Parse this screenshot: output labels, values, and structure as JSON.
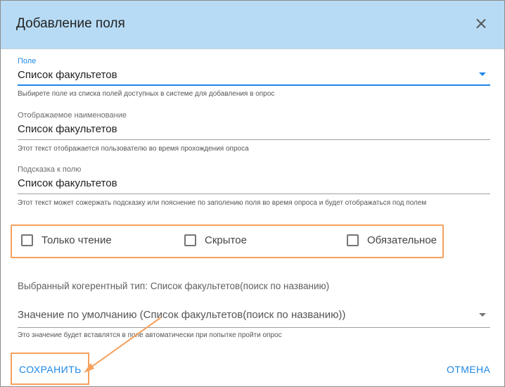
{
  "dialog": {
    "title": "Добавление поля",
    "close_icon": "close-icon"
  },
  "field": {
    "label": "Поле",
    "value": "Список факультетов",
    "hint": "Выбирете поле из списка полей доступных в системе для добавления в опрос"
  },
  "display_name": {
    "label": "Отображаемое наименование",
    "value": "Список факультетов",
    "hint": "Этот текст отображается пользователю во время прохождения опроса"
  },
  "tooltip_field": {
    "label": "Подсказка к полю",
    "value": "Список факультетов",
    "hint": "Этот текст может сожержать подсказку или пояснение по заполению поля во время опроса и будет отображаться под полем"
  },
  "checkboxes": [
    {
      "label": "Только чтение",
      "checked": false
    },
    {
      "label": "Скрытое",
      "checked": false
    },
    {
      "label": "Обязательное",
      "checked": false
    }
  ],
  "coherent_type": "Выбранный когерентный тип: Список факультетов(поиск по названию)",
  "default_value": {
    "placeholder": "Значение по умолчанию (Список факультетов(поиск по названию))",
    "hint": "Это значение будет вставлятся в поле автоматически при попытке пройти опрос"
  },
  "actions": {
    "save": "СОХРАНИТЬ",
    "cancel": "ОТМЕНА"
  },
  "colors": {
    "header_bg": "#b7dbf5",
    "accent": "#1e88e5",
    "highlight": "#f5a15e"
  }
}
